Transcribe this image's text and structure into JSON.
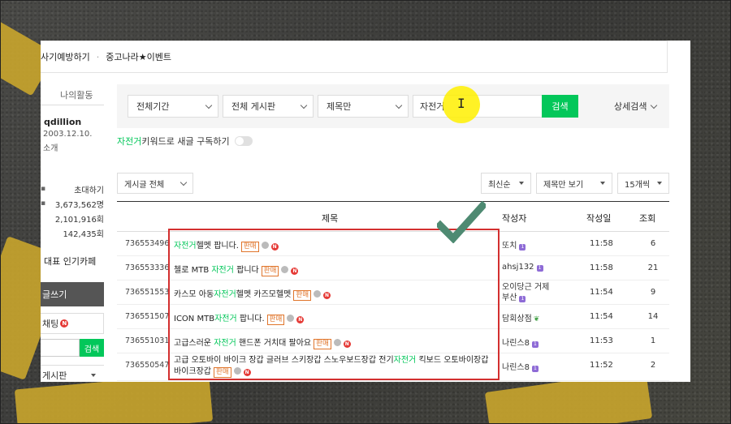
{
  "topbar": {
    "item1": "사기예방하기",
    "sep": "·",
    "item2": "중고나라★이벤트"
  },
  "sidebar": {
    "tab1": "",
    "tab2": "나의활동",
    "user_id": "qdillion",
    "join_date": "2003.12.10.",
    "intro": "소개",
    "invite": "초대하기",
    "stat1": "3,673,562명",
    "stat2": "2,101,916회",
    "stat3": "142,435회",
    "popular": "대표 인기카페",
    "write": "글쓰기",
    "chat": "채팅",
    "chat_badge": "N",
    "search_btn": "검색",
    "board": "게시판"
  },
  "search": {
    "period": "전체기간",
    "board": "전체 게시판",
    "scope": "제목만",
    "keyword": "자전거",
    "button": "검색",
    "advanced": "상세검색"
  },
  "subscribe": {
    "keyword": "자전거",
    "text": " 키워드로 새글 구독하기"
  },
  "filters": {
    "posts": "게시글 전체",
    "sort": "최신순",
    "view": "제목만 보기",
    "count": "15개씩"
  },
  "table": {
    "headers": {
      "title": "제목",
      "author": "작성자",
      "date": "작성일",
      "views": "조회"
    },
    "tag": "판매",
    "new": "N",
    "level": "1",
    "rows": [
      {
        "num": "736553496",
        "pre": "",
        "kw": "자전거",
        "post": "헬멧 팝니다.",
        "author": "또치",
        "time": "11:58",
        "views": "6"
      },
      {
        "num": "736553336",
        "pre": "첼로 MTB ",
        "kw": "자전거",
        "post": " 팝니다",
        "author": "ahsj132",
        "time": "11:58",
        "views": "21"
      },
      {
        "num": "736551553",
        "pre": "카스모 아동",
        "kw": "자전거",
        "post": "헬멧 카즈모헬멧",
        "author": "오이당근 거제부산",
        "time": "11:54",
        "views": "9"
      },
      {
        "num": "736551507",
        "pre": "ICON MTB",
        "kw": "자전거",
        "post": " 팝니다.",
        "author": "담회상점",
        "time": "11:54",
        "views": "14"
      },
      {
        "num": "736551031",
        "pre": "고급스러운 ",
        "kw": "자전거",
        "post": " 핸드폰 거치대 팔아요",
        "author": "나린스8",
        "time": "11:53",
        "views": "1"
      },
      {
        "num": "736550547",
        "pre": "고급 오토바이 바이크 장갑 글러브 스키장갑 스노우보드장갑 전기",
        "kw": "자전거",
        "post": " 킥보드 오토바이장갑 바이크장갑",
        "author": "나린스8",
        "time": "11:52",
        "views": "2"
      }
    ]
  },
  "colors": {
    "accent": "#03c75a",
    "annotation": "#d32f2f",
    "check": "#4e8a72"
  }
}
